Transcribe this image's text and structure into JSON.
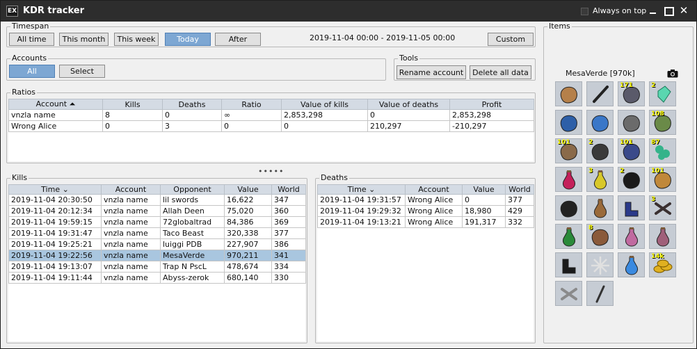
{
  "window": {
    "icon_text": "EX",
    "title": "KDR tracker",
    "always_on_top_label": "Always on top",
    "minimize": "",
    "maximize": "",
    "close": "✕"
  },
  "timespan": {
    "legend": "Timespan",
    "buttons": [
      "All time",
      "This month",
      "This week",
      "Today",
      "After"
    ],
    "active": "Today",
    "range": "2019-11-04 00:00 - 2019-11-05 00:00",
    "custom_label": "Custom"
  },
  "accounts": {
    "legend": "Accounts",
    "all_label": "All",
    "select_label": "Select"
  },
  "tools": {
    "legend": "Tools",
    "rename_label": "Rename account",
    "delete_label": "Delete all data"
  },
  "ratios": {
    "legend": "Ratios",
    "columns": [
      "Account ⏶",
      "Kills",
      "Deaths",
      "Ratio",
      "Value of kills",
      "Value of deaths",
      "Profit"
    ],
    "rows": [
      [
        "vnzla name",
        "8",
        "0",
        "∞",
        "2,853,298",
        "0",
        "2,853,298"
      ],
      [
        "Wrong Alice",
        "0",
        "3",
        "0",
        "0",
        "210,297",
        "-210,297"
      ]
    ]
  },
  "splitter": "•••••",
  "kills": {
    "legend": "Kills",
    "columns": [
      "Time ⌄",
      "Account",
      "Opponent",
      "Value",
      "World"
    ],
    "rows": [
      [
        "2019-11-04 20:30:50",
        "vnzla name",
        "lil swords",
        "16,622",
        "347"
      ],
      [
        "2019-11-04 20:12:34",
        "vnzla name",
        "Allah Deen",
        "75,020",
        "360"
      ],
      [
        "2019-11-04 19:59:15",
        "vnzla name",
        "72globaltrad",
        "84,386",
        "369"
      ],
      [
        "2019-11-04 19:31:47",
        "vnzla name",
        "Taco Beast",
        "320,338",
        "377"
      ],
      [
        "2019-11-04 19:25:21",
        "vnzla name",
        "luiggi PDB",
        "227,907",
        "386"
      ],
      [
        "2019-11-04 19:22:56",
        "vnzla name",
        "MesaVerde",
        "970,211",
        "341"
      ],
      [
        "2019-11-04 19:13:07",
        "vnzla name",
        "Trap N PscL",
        "478,674",
        "334"
      ],
      [
        "2019-11-04 19:11:44",
        "vnzla name",
        "Abyss-zerok",
        "680,140",
        "330"
      ]
    ],
    "selected_index": 5
  },
  "deaths": {
    "legend": "Deaths",
    "columns": [
      "Time ⌄",
      "Account",
      "Value",
      "World"
    ],
    "rows": [
      [
        "2019-11-04 19:31:57",
        "Wrong Alice",
        "0",
        "377"
      ],
      [
        "2019-11-04 19:29:32",
        "Wrong Alice",
        "18,980",
        "429"
      ],
      [
        "2019-11-04 19:13:21",
        "Wrong Alice",
        "191,317",
        "332"
      ]
    ]
  },
  "items": {
    "legend": "Items",
    "title": "MesaVerde [970k]",
    "slots": [
      {
        "icon": "amulet-icon",
        "qty": ""
      },
      {
        "icon": "blowpipe-icon",
        "qty": ""
      },
      {
        "icon": "bolts-icon",
        "qty": "171"
      },
      {
        "icon": "gem-icon",
        "qty": "2"
      },
      {
        "icon": "gloves-icon",
        "qty": ""
      },
      {
        "icon": "cape-icon",
        "qty": ""
      },
      {
        "icon": "legs-icon",
        "qty": ""
      },
      {
        "icon": "pizza-icon",
        "qty": "108"
      },
      {
        "icon": "bread-icon",
        "qty": "101"
      },
      {
        "icon": "crossbow-icon",
        "qty": "2"
      },
      {
        "icon": "rune-icon",
        "qty": "101"
      },
      {
        "icon": "ore-icon",
        "qty": "87"
      },
      {
        "icon": "potion-icon",
        "qty": ""
      },
      {
        "icon": "potion-icon",
        "qty": "3"
      },
      {
        "icon": "book-icon",
        "qty": "2"
      },
      {
        "icon": "cake-icon",
        "qty": "101"
      },
      {
        "icon": "shield-icon",
        "qty": ""
      },
      {
        "icon": "potion-icon",
        "qty": ""
      },
      {
        "icon": "boots-icon",
        "qty": ""
      },
      {
        "icon": "bones-icon",
        "qty": "3"
      },
      {
        "icon": "potion-icon",
        "qty": ""
      },
      {
        "icon": "hide-icon",
        "qty": "8"
      },
      {
        "icon": "potion-icon",
        "qty": ""
      },
      {
        "icon": "potion-icon",
        "qty": ""
      },
      {
        "icon": "boots-icon",
        "qty": ""
      },
      {
        "icon": "star-icon",
        "qty": ""
      },
      {
        "icon": "potion-icon",
        "qty": ""
      },
      {
        "icon": "coins-icon",
        "qty": "14k"
      },
      {
        "icon": "bones-icon",
        "qty": ""
      },
      {
        "icon": "staff-icon",
        "qty": ""
      }
    ],
    "slot_colors": [
      "#b5804a",
      "#222222",
      "#5a5a6a",
      "#5ad6b0",
      "#2d5fa8",
      "#3a77c8",
      "#6b6b6b",
      "#6a8a48",
      "#8a6a4a",
      "#3a3a3a",
      "#3a4a8a",
      "#34b38a",
      "#c4205a",
      "#d8c82a",
      "#1a1a1a",
      "#c0883a",
      "#222222",
      "#9a6a3a",
      "#2a3a8a",
      "#3a3030",
      "#2a8a3a",
      "#8a5a3a",
      "#c06aa0",
      "#a0607a",
      "#1a1a1a",
      "#e0e0e0",
      "#3a8ae0",
      "#e0b020",
      "#8a8a8a",
      "#333333"
    ]
  }
}
